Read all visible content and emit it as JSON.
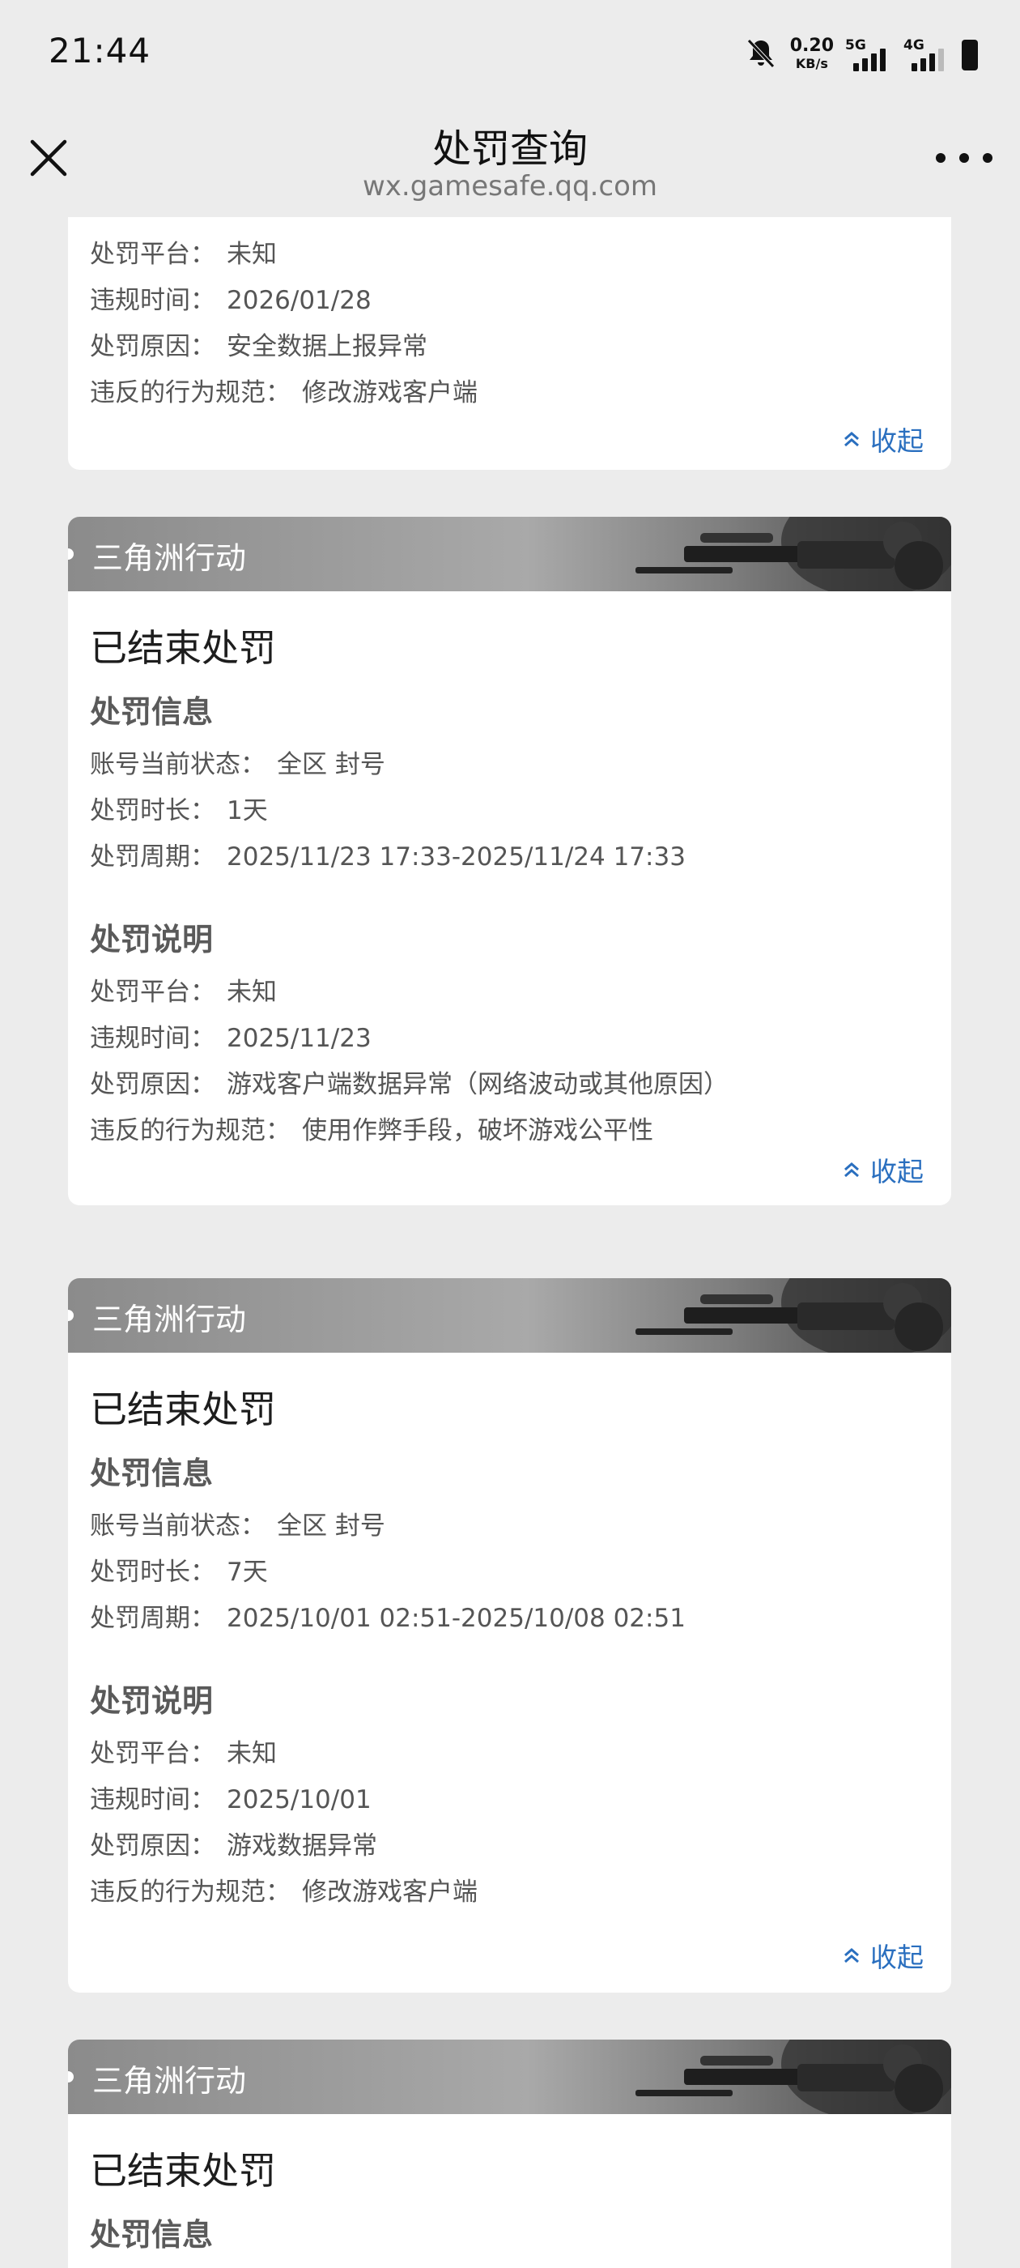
{
  "status_bar": {
    "time": "21:44",
    "speed_value": "0.20",
    "speed_unit": "KB/s",
    "net1": "5G",
    "net2": "4G"
  },
  "nav": {
    "title": "处罚查询",
    "url": "wx.gamesafe.qq.com"
  },
  "collapse_label": "收起",
  "cards": [
    {
      "partial": true,
      "platform_label": "处罚平台：",
      "platform": "未知",
      "time_label": "违规时间：",
      "time": "2026/01/28",
      "reason_label": "处罚原因：",
      "reason": "安全数据上报异常",
      "rule_label": "违反的行为规范：",
      "rule": "修改游戏客户端"
    },
    {
      "game": "三角洲行动",
      "status": "已结束处罚",
      "info_title": "处罚信息",
      "state_label": "账号当前状态：",
      "state": "全区 封号",
      "duration_label": "处罚时长：",
      "duration": "1天",
      "period_label": "处罚周期：",
      "period": "2025/11/23 17:33-2025/11/24 17:33",
      "desc_title": "处罚说明",
      "platform_label": "处罚平台：",
      "platform": "未知",
      "time_label": "违规时间：",
      "time": "2025/11/23",
      "reason_label": "处罚原因：",
      "reason": "游戏客户端数据异常（网络波动或其他原因）",
      "rule_label": "违反的行为规范：",
      "rule": "使用作弊手段，破坏游戏公平性"
    },
    {
      "game": "三角洲行动",
      "status": "已结束处罚",
      "info_title": "处罚信息",
      "state_label": "账号当前状态：",
      "state": "全区 封号",
      "duration_label": "处罚时长：",
      "duration": "7天",
      "period_label": "处罚周期：",
      "period": "2025/10/01 02:51-2025/10/08 02:51",
      "desc_title": "处罚说明",
      "platform_label": "处罚平台：",
      "platform": "未知",
      "time_label": "违规时间：",
      "time": "2025/10/01",
      "reason_label": "处罚原因：",
      "reason": "游戏数据异常",
      "rule_label": "违反的行为规范：",
      "rule": "修改游戏客户端"
    },
    {
      "game": "三角洲行动",
      "status": "已结束处罚",
      "info_title": "处罚信息"
    }
  ]
}
